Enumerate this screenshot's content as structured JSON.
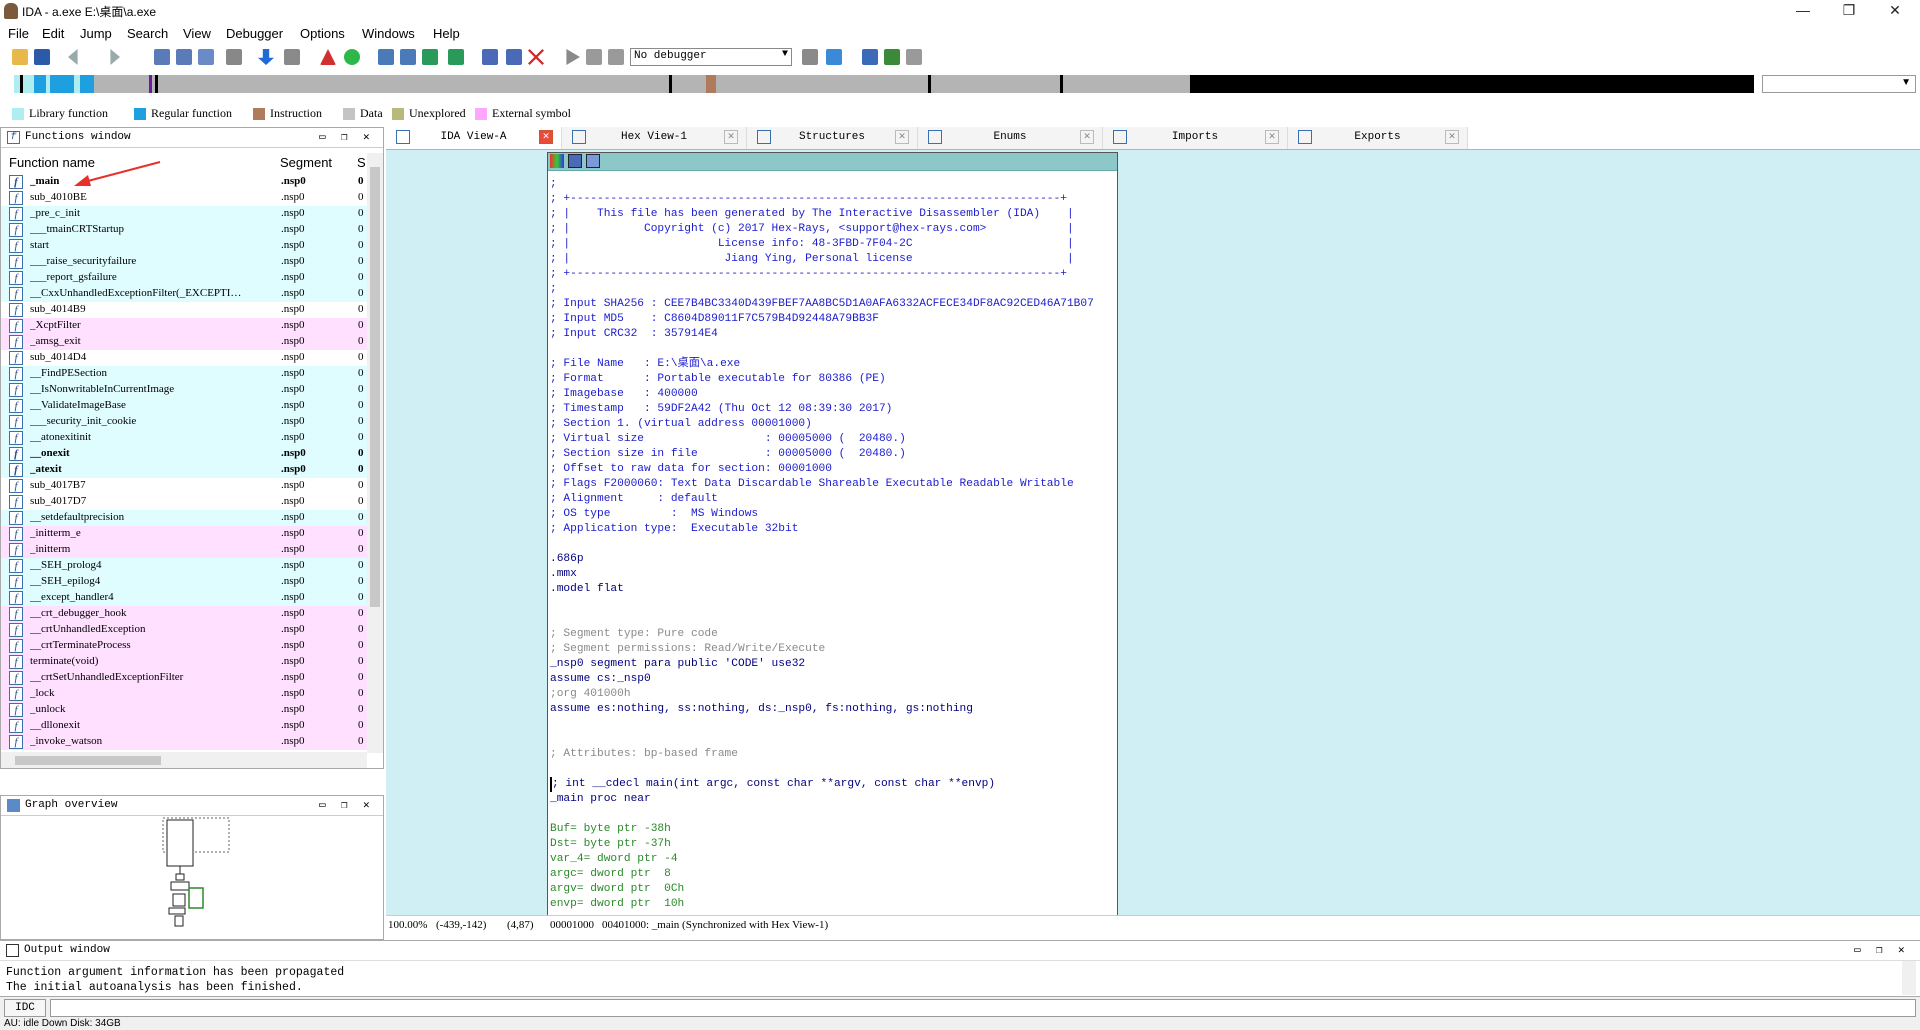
{
  "window": {
    "title": "IDA - a.exe E:\\桌面\\a.exe",
    "minimize": "—",
    "restore": "❐",
    "close": "✕"
  },
  "menu": [
    "File",
    "Edit",
    "Jump",
    "Search",
    "View",
    "Debugger",
    "Options",
    "Windows",
    "Help"
  ],
  "toolbar": {
    "debugger_select": "No debugger"
  },
  "legend": [
    {
      "label": "Library function",
      "color": "#aeeef0"
    },
    {
      "label": "Regular function",
      "color": "#1e9fe0"
    },
    {
      "label": "Instruction",
      "color": "#b07a5c"
    },
    {
      "label": "Data",
      "color": "#c4c4c4"
    },
    {
      "label": "Unexplored",
      "color": "#b8ba7c"
    },
    {
      "label": "External symbol",
      "color": "#ffa6ff"
    }
  ],
  "functions_window": {
    "title": "Functions window",
    "col_name": "Function name",
    "col_segment": "Segment",
    "col_s": "S",
    "rows": [
      {
        "name": "_main",
        "seg": ".nsp0",
        "s": "0",
        "bold": true,
        "bg": "#ffffff"
      },
      {
        "name": "sub_4010BE",
        "seg": ".nsp0",
        "s": "0",
        "bold": false,
        "bg": "#ffffff"
      },
      {
        "name": "_pre_c_init",
        "seg": ".nsp0",
        "s": "0",
        "bold": false,
        "bg": "#dffcff"
      },
      {
        "name": "___tmainCRTStartup",
        "seg": ".nsp0",
        "s": "0",
        "bold": false,
        "bg": "#dffcff"
      },
      {
        "name": "start",
        "seg": ".nsp0",
        "s": "0",
        "bold": false,
        "bg": "#dffcff"
      },
      {
        "name": "___raise_securityfailure",
        "seg": ".nsp0",
        "s": "0",
        "bold": false,
        "bg": "#dffcff"
      },
      {
        "name": "___report_gsfailure",
        "seg": ".nsp0",
        "s": "0",
        "bold": false,
        "bg": "#dffcff"
      },
      {
        "name": "__CxxUnhandledExceptionFilter(_EXCEPTI…",
        "seg": ".nsp0",
        "s": "0",
        "bold": false,
        "bg": "#dffcff"
      },
      {
        "name": "sub_4014B9",
        "seg": ".nsp0",
        "s": "0",
        "bold": false,
        "bg": "#ffffff"
      },
      {
        "name": "_XcptFilter",
        "seg": ".nsp0",
        "s": "0",
        "bold": false,
        "bg": "#ffe0ff"
      },
      {
        "name": "_amsg_exit",
        "seg": ".nsp0",
        "s": "0",
        "bold": false,
        "bg": "#ffe0ff"
      },
      {
        "name": "sub_4014D4",
        "seg": ".nsp0",
        "s": "0",
        "bold": false,
        "bg": "#ffffff"
      },
      {
        "name": "__FindPESection",
        "seg": ".nsp0",
        "s": "0",
        "bold": false,
        "bg": "#dffcff"
      },
      {
        "name": "__IsNonwritableInCurrentImage",
        "seg": ".nsp0",
        "s": "0",
        "bold": false,
        "bg": "#dffcff"
      },
      {
        "name": "__ValidateImageBase",
        "seg": ".nsp0",
        "s": "0",
        "bold": false,
        "bg": "#dffcff"
      },
      {
        "name": "___security_init_cookie",
        "seg": ".nsp0",
        "s": "0",
        "bold": false,
        "bg": "#dffcff"
      },
      {
        "name": "__atonexitinit",
        "seg": ".nsp0",
        "s": "0",
        "bold": false,
        "bg": "#dffcff"
      },
      {
        "name": "__onexit",
        "seg": ".nsp0",
        "s": "0",
        "bold": true,
        "bg": "#dffcff"
      },
      {
        "name": "_atexit",
        "seg": ".nsp0",
        "s": "0",
        "bold": true,
        "bg": "#dffcff"
      },
      {
        "name": "sub_4017B7",
        "seg": ".nsp0",
        "s": "0",
        "bold": false,
        "bg": "#ffffff"
      },
      {
        "name": "sub_4017D7",
        "seg": ".nsp0",
        "s": "0",
        "bold": false,
        "bg": "#ffffff"
      },
      {
        "name": "__setdefaultprecision",
        "seg": ".nsp0",
        "s": "0",
        "bold": false,
        "bg": "#dffcff"
      },
      {
        "name": "_initterm_e",
        "seg": ".nsp0",
        "s": "0",
        "bold": false,
        "bg": "#ffe0ff"
      },
      {
        "name": "_initterm",
        "seg": ".nsp0",
        "s": "0",
        "bold": false,
        "bg": "#ffe0ff"
      },
      {
        "name": "__SEH_prolog4",
        "seg": ".nsp0",
        "s": "0",
        "bold": false,
        "bg": "#dffcff"
      },
      {
        "name": "__SEH_epilog4",
        "seg": ".nsp0",
        "s": "0",
        "bold": false,
        "bg": "#dffcff"
      },
      {
        "name": "__except_handler4",
        "seg": ".nsp0",
        "s": "0",
        "bold": false,
        "bg": "#dffcff"
      },
      {
        "name": "__crt_debugger_hook",
        "seg": ".nsp0",
        "s": "0",
        "bold": false,
        "bg": "#ffe0ff"
      },
      {
        "name": "__crtUnhandledException",
        "seg": ".nsp0",
        "s": "0",
        "bold": false,
        "bg": "#ffe0ff"
      },
      {
        "name": "__crtTerminateProcess",
        "seg": ".nsp0",
        "s": "0",
        "bold": false,
        "bg": "#ffe0ff"
      },
      {
        "name": "terminate(void)",
        "seg": ".nsp0",
        "s": "0",
        "bold": false,
        "bg": "#ffe0ff"
      },
      {
        "name": "__crtSetUnhandledExceptionFilter",
        "seg": ".nsp0",
        "s": "0",
        "bold": false,
        "bg": "#ffe0ff"
      },
      {
        "name": "_lock",
        "seg": ".nsp0",
        "s": "0",
        "bold": false,
        "bg": "#ffe0ff"
      },
      {
        "name": "_unlock",
        "seg": ".nsp0",
        "s": "0",
        "bold": false,
        "bg": "#ffe0ff"
      },
      {
        "name": "__dllonexit",
        "seg": ".nsp0",
        "s": "0",
        "bold": false,
        "bg": "#ffe0ff"
      },
      {
        "name": "_invoke_watson",
        "seg": ".nsp0",
        "s": "0",
        "bold": false,
        "bg": "#ffe0ff"
      }
    ]
  },
  "graph_overview": {
    "title": "Graph overview"
  },
  "tabs": [
    {
      "label": "IDA View-A",
      "active": true
    },
    {
      "label": "Hex View-1",
      "active": false
    },
    {
      "label": "Structures",
      "active": false
    },
    {
      "label": "Enums",
      "active": false
    },
    {
      "label": "Imports",
      "active": false
    },
    {
      "label": "Exports",
      "active": false
    }
  ],
  "code_lines": [
    {
      "t": ";",
      "c": "blue"
    },
    {
      "t": "; +-------------------------------------------------------------------------+",
      "c": "blue"
    },
    {
      "t": "; |    This file has been generated by The Interactive Disassembler (IDA)    |",
      "c": "blue"
    },
    {
      "t": "; |           Copyright (c) 2017 Hex-Rays, <support@hex-rays.com>            |",
      "c": "blue"
    },
    {
      "t": "; |                      License info: 48-3FBD-7F04-2C                       |",
      "c": "blue"
    },
    {
      "t": "; |                       Jiang Ying, Personal license                       |",
      "c": "blue"
    },
    {
      "t": "; +-------------------------------------------------------------------------+",
      "c": "blue"
    },
    {
      "t": ";",
      "c": "blue"
    },
    {
      "t": "; Input SHA256 : CEE7B4BC3340D439FBEF7AA8BC5D1A0AFA6332ACFECE34DF8AC92CED46A71B07",
      "c": "blue"
    },
    {
      "t": "; Input MD5    : C8604D89011F7C579B4D92448A79BB3F",
      "c": "blue"
    },
    {
      "t": "; Input CRC32  : 357914E4",
      "c": "blue"
    },
    {
      "t": "",
      "c": "blue"
    },
    {
      "t": "; File Name   : E:\\桌面\\a.exe",
      "c": "blue"
    },
    {
      "t": "; Format      : Portable executable for 80386 (PE)",
      "c": "blue"
    },
    {
      "t": "; Imagebase   : 400000",
      "c": "blue"
    },
    {
      "t": "; Timestamp   : 59DF2A42 (Thu Oct 12 08:39:30 2017)",
      "c": "blue"
    },
    {
      "t": "; Section 1. (virtual address 00001000)",
      "c": "blue"
    },
    {
      "t": "; Virtual size                  : 00005000 (  20480.)",
      "c": "blue"
    },
    {
      "t": "; Section size in file          : 00005000 (  20480.)",
      "c": "blue"
    },
    {
      "t": "; Offset to raw data for section: 00001000",
      "c": "blue"
    },
    {
      "t": "; Flags F2000060: Text Data Discardable Shareable Executable Readable Writable",
      "c": "blue"
    },
    {
      "t": "; Alignment     : default",
      "c": "blue"
    },
    {
      "t": "; OS type         :  MS Windows",
      "c": "blue"
    },
    {
      "t": "; Application type:  Executable 32bit",
      "c": "blue"
    },
    {
      "t": "",
      "c": "blue"
    },
    {
      "t": ".686p",
      "c": "navy"
    },
    {
      "t": ".mmx",
      "c": "navy"
    },
    {
      "t": ".model flat",
      "c": "navy"
    },
    {
      "t": "",
      "c": "navy"
    },
    {
      "t": "",
      "c": "navy"
    },
    {
      "t": "; Segment type: Pure code",
      "c": "gray"
    },
    {
      "t": "; Segment permissions: Read/Write/Execute",
      "c": "gray"
    },
    {
      "t": "_nsp0 segment para public 'CODE' use32",
      "c": "navy"
    },
    {
      "t": "assume cs:_nsp0",
      "c": "navy"
    },
    {
      "t": ";org 401000h",
      "c": "gray"
    },
    {
      "t": "assume es:nothing, ss:nothing, ds:_nsp0, fs:nothing, gs:nothing",
      "c": "navy"
    },
    {
      "t": "",
      "c": "navy"
    },
    {
      "t": "",
      "c": "navy"
    },
    {
      "t": "; Attributes: bp-based frame",
      "c": "gray"
    },
    {
      "t": "",
      "c": "navy"
    },
    {
      "t": "; int __cdecl main(int argc, const char **argv, const char **envp)",
      "c": "navy",
      "cursor": true
    },
    {
      "t": "_main proc near",
      "c": "navy"
    },
    {
      "t": "",
      "c": "navy"
    },
    {
      "t": "Buf= byte ptr -38h",
      "c": "green"
    },
    {
      "t": "Dst= byte ptr -37h",
      "c": "green"
    },
    {
      "t": "var_4= dword ptr -4",
      "c": "green"
    },
    {
      "t": "argc= dword ptr  8",
      "c": "green"
    },
    {
      "t": "argv= dword ptr  0Ch",
      "c": "green"
    },
    {
      "t": "envp= dword ptr  10h",
      "c": "green"
    }
  ],
  "status": {
    "zoom": "100.00%",
    "coords": "(-439,-142)",
    "pos": "(4,87)",
    "offset": "00001000",
    "address": "00401000: _main (Synchronized with Hex View-1)"
  },
  "output_window": {
    "title": "Output window",
    "lines": "Function argument information has been propagated\nThe initial autoanalysis has been finished."
  },
  "idc": {
    "button": "IDC"
  },
  "bottom_status": "AU: idle   Down   Disk: 34GB"
}
